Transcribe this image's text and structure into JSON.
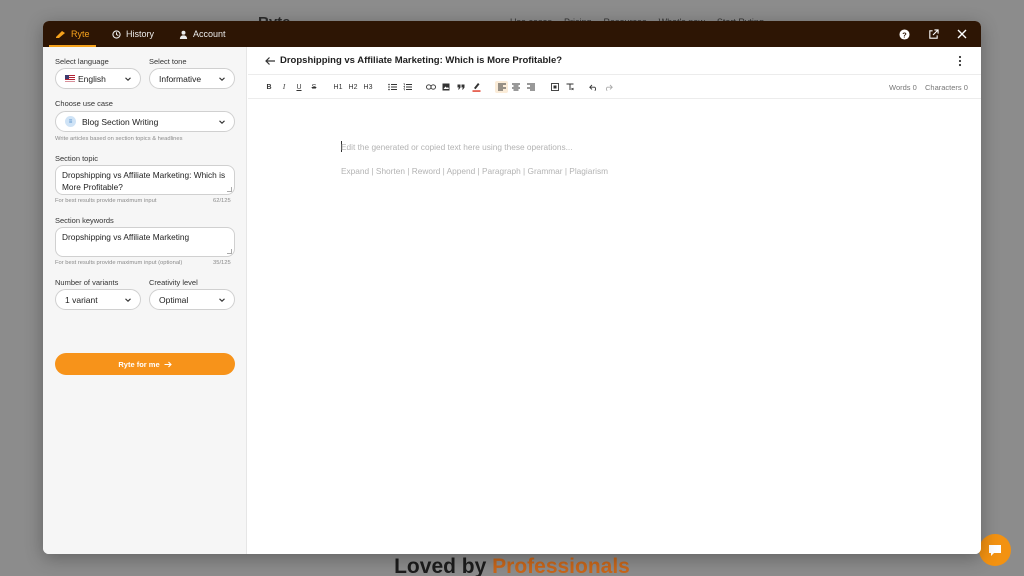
{
  "background": {
    "logo": "Ryte",
    "nav_links": [
      "Use cases",
      "Pricing",
      "Resources",
      "What's new",
      "Start Ryting →"
    ],
    "footer_title_prefix": "Loved by ",
    "footer_title_highlight": "Professionals"
  },
  "topbar": {
    "tabs": [
      {
        "label": "Ryte",
        "icon": "writing-hand-icon",
        "active": true
      },
      {
        "label": "History",
        "icon": "history-icon",
        "active": false
      },
      {
        "label": "Account",
        "icon": "user-icon",
        "active": false
      }
    ],
    "icons": [
      "help-icon",
      "external-link-icon",
      "close-icon"
    ]
  },
  "sidebar": {
    "language": {
      "label": "Select language",
      "value": "English"
    },
    "tone": {
      "label": "Select tone",
      "value": "Informative"
    },
    "use_case": {
      "label": "Choose use case",
      "value": "Blog Section Writing",
      "hint": "Write articles based on section topics & headlines"
    },
    "topic": {
      "label": "Section topic",
      "value": "Dropshipping vs Affiliate Marketing: Which is More Profitable?",
      "hint": "For best results provide maximum input",
      "counter": "62/125"
    },
    "keywords": {
      "label": "Section keywords",
      "value": "Dropshipping vs Affiliate Marketing",
      "hint": "For best results provide maximum input (optional)",
      "counter": "35/125"
    },
    "variants": {
      "label": "Number of variants",
      "value": "1 variant"
    },
    "creativity": {
      "label": "Creativity level",
      "value": "Optimal"
    },
    "cta_label": "Ryte for me"
  },
  "editor": {
    "title": "Dropshipping vs Affiliate Marketing: Which is More Profitable?",
    "toolbar": {
      "bold": "B",
      "italic": "I",
      "underline": "U",
      "strike": "S",
      "h1": "H1",
      "h2": "H2",
      "h3": "H3"
    },
    "words": "Words 0",
    "characters": "Characters 0",
    "placeholder": "Edit the generated or copied text here using these operations...",
    "operations": "Expand | Shorten | Reword | Append | Paragraph | Grammar | Plagiarism"
  },
  "colors": {
    "topbar": "#2d1504",
    "accent": "#f7931a",
    "active_tab": "#f6a21c"
  }
}
